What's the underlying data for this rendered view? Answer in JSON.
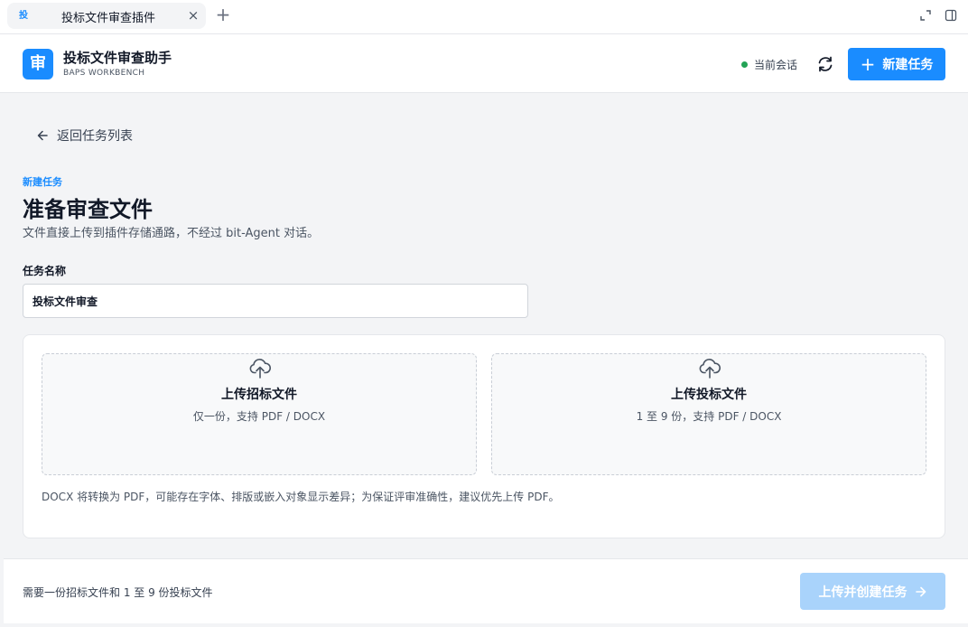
{
  "browser": {
    "tab": {
      "favicon_text": "投",
      "title": "投标文件审查插件",
      "close_glyph": "×"
    },
    "new_tab_glyph": "+"
  },
  "header": {
    "logo_text": "审",
    "title": "投标文件审查助手",
    "subtitle": "BAPS WORKBENCH",
    "session_label": "当前会话",
    "new_task_label": "新建任务",
    "new_task_glyph": "+"
  },
  "main": {
    "back_label": "返回任务列表",
    "eyebrow": "新建任务",
    "title": "准备审查文件",
    "description": "文件直接上传到插件存储通路，不经过 bit-Agent 对话。",
    "task_name": {
      "label": "任务名称",
      "value": "投标文件审查"
    },
    "uploads": [
      {
        "title": "上传招标文件",
        "hint": "仅一份，支持 PDF / DOCX"
      },
      {
        "title": "上传投标文件",
        "hint": "1 至 9 份，支持 PDF / DOCX"
      }
    ],
    "note": "DOCX 将转换为 PDF，可能存在字体、排版或嵌入对象显示差异；为保证评审准确性，建议优先上传 PDF。"
  },
  "footer": {
    "requirement_text": "需要一份招标文件和 1 至 9 份投标文件",
    "submit_label": "上传并创建任务"
  },
  "colors": {
    "accent": "#1a8cff",
    "accent_disabled": "#a9d3fb",
    "status_online": "#22a355"
  },
  "icons": {
    "tab_close": "close-icon",
    "new_tab": "plus-icon",
    "refresh": "refresh-icon",
    "back": "arrow-left-icon",
    "upload": "cloud-upload-icon",
    "submit": "arrow-right-icon"
  }
}
